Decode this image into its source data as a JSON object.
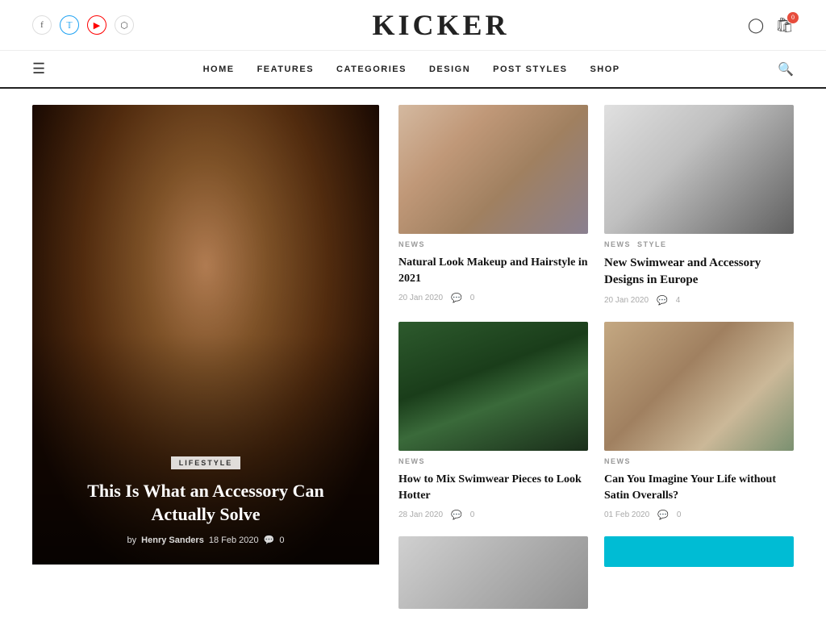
{
  "site": {
    "title": "KICKER"
  },
  "social": [
    {
      "name": "facebook",
      "label": "f",
      "class": "facebook"
    },
    {
      "name": "twitter",
      "label": "𝕏",
      "class": "twitter"
    },
    {
      "name": "youtube",
      "label": "▶",
      "class": "youtube"
    },
    {
      "name": "instagram",
      "label": "◻",
      "class": "instagram"
    }
  ],
  "nav": {
    "items": [
      {
        "label": "HOME",
        "href": "#"
      },
      {
        "label": "FEATURES",
        "href": "#"
      },
      {
        "label": "CATEGORIES",
        "href": "#"
      },
      {
        "label": "DESIGN",
        "href": "#"
      },
      {
        "label": "POST STYLES",
        "href": "#"
      },
      {
        "label": "SHOP",
        "href": "#"
      }
    ]
  },
  "featured": {
    "category": "LIFESTYLE",
    "title": "This Is What an Accessory Can Actually Solve",
    "by": "by",
    "author": "Henry Sanders",
    "date": "18 Feb 2020",
    "comments": "0"
  },
  "articles": [
    {
      "id": "makeup",
      "tags": [
        "NEWS"
      ],
      "title": "Natural Look Makeup and Hairstyle in 2021",
      "date": "20 Jan 2020",
      "comments": "0",
      "imgClass": "img-makeup"
    },
    {
      "id": "hat",
      "tags": [
        "NEWS",
        "STYLE"
      ],
      "title": "New Swimwear and Accessory Designs in Europe",
      "date": "20 Jan 2020",
      "comments": "4",
      "imgClass": "img-hat"
    },
    {
      "id": "swimwear",
      "tags": [
        "NEWS"
      ],
      "title": "How to Mix Swimwear Pieces to Look Hotter",
      "date": "28 Jan 2020",
      "comments": "0",
      "imgClass": "img-swimwear1"
    },
    {
      "id": "overalls",
      "tags": [
        "NEWS"
      ],
      "title": "Can You Imagine Your Life without Satin Overalls?",
      "date": "01 Feb 2020",
      "comments": "0",
      "imgClass": "img-overalls"
    }
  ],
  "cart_count": "0"
}
